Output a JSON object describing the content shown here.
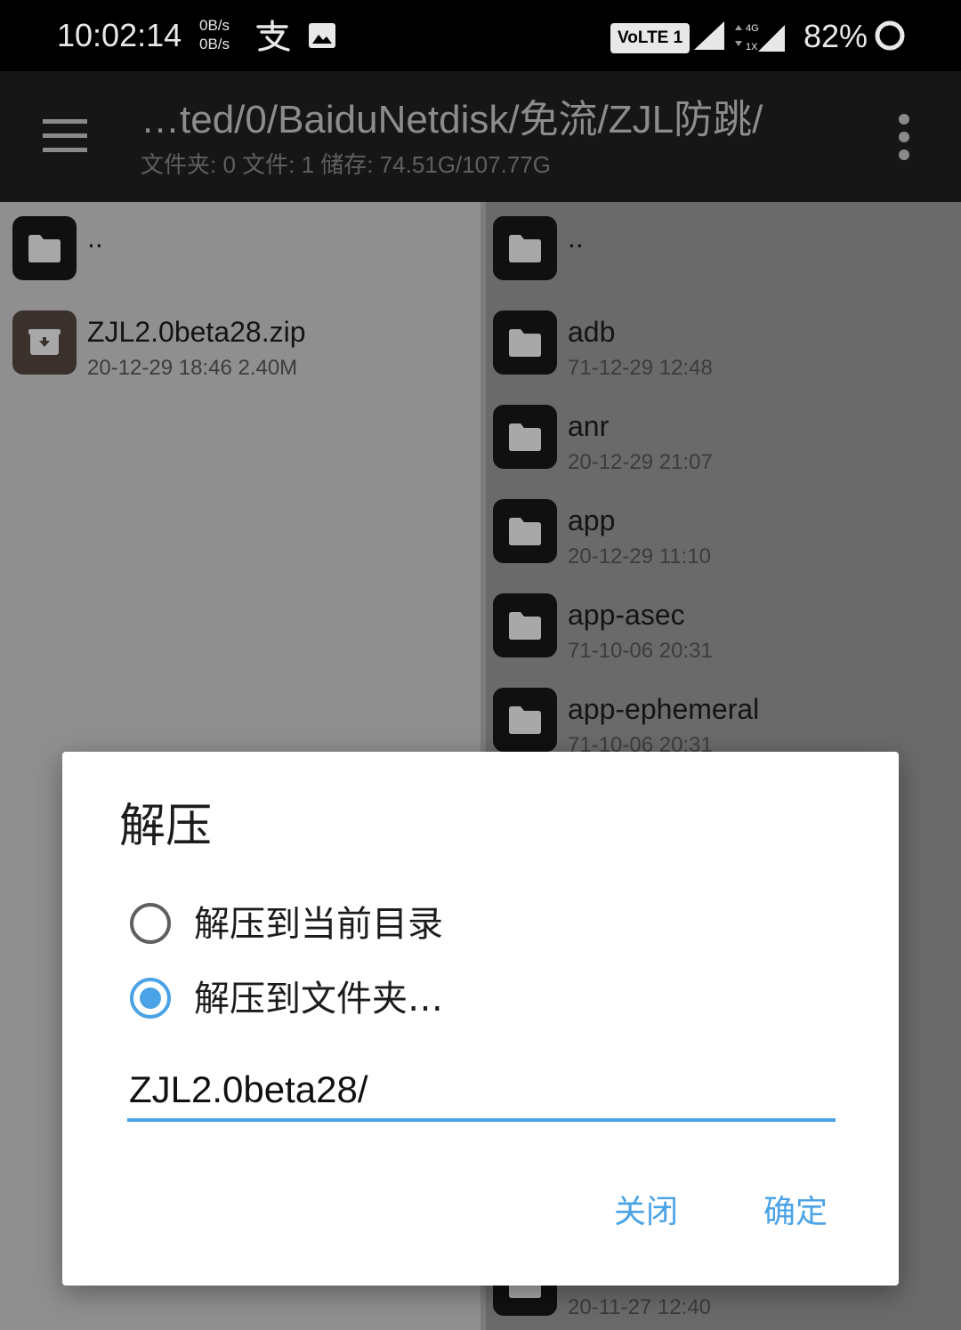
{
  "status_bar": {
    "time": "10:02:14",
    "net_up": "0B/s",
    "net_down": "0B/s",
    "volte": "VoLTE 1",
    "net_type": "4G",
    "net_sub": "1X",
    "battery": "82%"
  },
  "toolbar": {
    "path": "…ted/0/BaiduNetdisk/免流/ZJL防跳/",
    "stats": "文件夹: 0  文件: 1  储存: 74.51G/107.77G"
  },
  "left_pane": {
    "items": [
      {
        "name": "..",
        "meta": "",
        "type": "folder"
      },
      {
        "name": "ZJL2.0beta28.zip",
        "meta": "20-12-29 18:46  2.40M",
        "type": "archive"
      }
    ]
  },
  "right_pane": {
    "items": [
      {
        "name": "..",
        "meta": "",
        "type": "folder"
      },
      {
        "name": "adb",
        "meta": "71-12-29 12:48",
        "type": "folder"
      },
      {
        "name": "anr",
        "meta": "20-12-29 21:07",
        "type": "folder"
      },
      {
        "name": "app",
        "meta": "20-12-29 11:10",
        "type": "folder"
      },
      {
        "name": "app-asec",
        "meta": "71-10-06 20:31",
        "type": "folder"
      },
      {
        "name": "app-ephemeral",
        "meta": "71-10-06 20:31",
        "type": "folder"
      }
    ],
    "bottom_item_meta": "20-11-27 12:40"
  },
  "dialog": {
    "title": "解压",
    "option_current": "解压到当前目录",
    "option_folder": "解压到文件夹…",
    "selected": "option_folder",
    "folder_value": "ZJL2.0beta28/",
    "close_label": "关闭",
    "ok_label": "确定"
  },
  "colors": {
    "accent": "#4aa3e6",
    "toolbar_bg": "#161616",
    "status_bg": "#000000"
  }
}
